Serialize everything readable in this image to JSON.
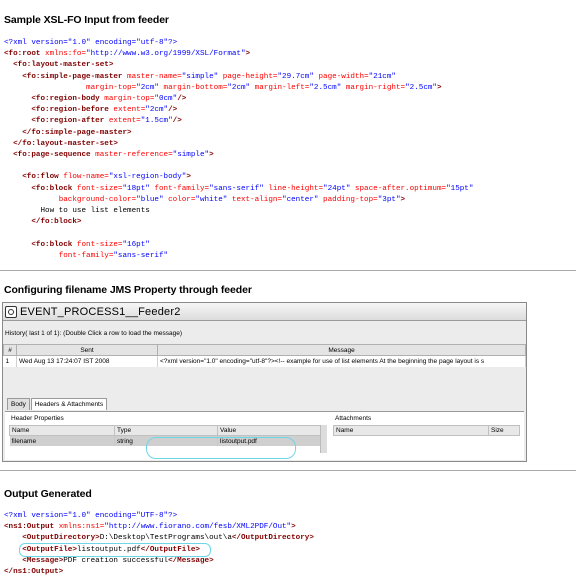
{
  "section1": {
    "heading": "Sample XSL-FO Input from feeder",
    "lines": [
      [
        {
          "c": "pi",
          "t": "<?xml version=\"1.0\" encoding=\"utf-8\"?>"
        }
      ],
      [
        {
          "c": "tag",
          "t": "<fo:root"
        },
        {
          "c": "attr",
          "t": " xmlns:fo="
        },
        {
          "c": "val",
          "t": "\"http://www.w3.org/1999/XSL/Format\""
        },
        {
          "c": "tag",
          "t": ">"
        }
      ],
      [
        {
          "c": "txt",
          "t": "  "
        },
        {
          "c": "tag",
          "t": "<fo:layout-master-set>"
        }
      ],
      [
        {
          "c": "txt",
          "t": "    "
        },
        {
          "c": "tag",
          "t": "<fo:simple-page-master"
        },
        {
          "c": "attr",
          "t": " master-name="
        },
        {
          "c": "val",
          "t": "\"simple\""
        },
        {
          "c": "attr",
          "t": " page-height="
        },
        {
          "c": "val",
          "t": "\"29.7cm\""
        },
        {
          "c": "attr",
          "t": " page-width="
        },
        {
          "c": "val",
          "t": "\"21cm\""
        }
      ],
      [
        {
          "c": "txt",
          "t": "                  "
        },
        {
          "c": "attr",
          "t": "margin-top="
        },
        {
          "c": "val",
          "t": "\"2cm\""
        },
        {
          "c": "attr",
          "t": " margin-bottom="
        },
        {
          "c": "val",
          "t": "\"2cm\""
        },
        {
          "c": "attr",
          "t": " margin-left="
        },
        {
          "c": "val",
          "t": "\"2.5cm\""
        },
        {
          "c": "attr",
          "t": " margin-right="
        },
        {
          "c": "val",
          "t": "\"2.5cm\""
        },
        {
          "c": "tag",
          "t": ">"
        }
      ],
      [
        {
          "c": "txt",
          "t": "      "
        },
        {
          "c": "tag",
          "t": "<fo:region-body"
        },
        {
          "c": "attr",
          "t": " margin-top="
        },
        {
          "c": "val",
          "t": "\"0cm\""
        },
        {
          "c": "tag",
          "t": "/>"
        }
      ],
      [
        {
          "c": "txt",
          "t": "      "
        },
        {
          "c": "tag",
          "t": "<fo:region-before"
        },
        {
          "c": "attr",
          "t": " extent="
        },
        {
          "c": "val",
          "t": "\"2cm\""
        },
        {
          "c": "tag",
          "t": "/>"
        }
      ],
      [
        {
          "c": "txt",
          "t": "      "
        },
        {
          "c": "tag",
          "t": "<fo:region-after"
        },
        {
          "c": "attr",
          "t": " extent="
        },
        {
          "c": "val",
          "t": "\"1.5cm\""
        },
        {
          "c": "tag",
          "t": "/>"
        }
      ],
      [
        {
          "c": "txt",
          "t": "    "
        },
        {
          "c": "tag",
          "t": "</fo:simple-page-master>"
        }
      ],
      [
        {
          "c": "txt",
          "t": "  "
        },
        {
          "c": "tag",
          "t": "</fo:layout-master-set>"
        }
      ],
      [
        {
          "c": "txt",
          "t": "  "
        },
        {
          "c": "tag",
          "t": "<fo:page-sequence"
        },
        {
          "c": "attr",
          "t": " master-reference="
        },
        {
          "c": "val",
          "t": "\"simple\""
        },
        {
          "c": "tag",
          "t": ">"
        }
      ],
      [
        {
          "c": "txt",
          "t": " "
        }
      ],
      [
        {
          "c": "txt",
          "t": "    "
        },
        {
          "c": "tag",
          "t": "<fo:flow"
        },
        {
          "c": "attr",
          "t": " flow-name="
        },
        {
          "c": "val",
          "t": "\"xsl-region-body\""
        },
        {
          "c": "tag",
          "t": ">"
        }
      ],
      [
        {
          "c": "txt",
          "t": "      "
        },
        {
          "c": "tag",
          "t": "<fo:block"
        },
        {
          "c": "attr",
          "t": " font-size="
        },
        {
          "c": "val",
          "t": "\"18pt\""
        },
        {
          "c": "attr",
          "t": " font-family="
        },
        {
          "c": "val",
          "t": "\"sans-serif\""
        },
        {
          "c": "attr",
          "t": " line-height="
        },
        {
          "c": "val",
          "t": "\"24pt\""
        },
        {
          "c": "attr",
          "t": " space-after.optimum="
        },
        {
          "c": "val",
          "t": "\"15pt\""
        }
      ],
      [
        {
          "c": "txt",
          "t": "            "
        },
        {
          "c": "attr",
          "t": "background-color="
        },
        {
          "c": "val",
          "t": "\"blue\""
        },
        {
          "c": "attr",
          "t": " color="
        },
        {
          "c": "val",
          "t": "\"white\""
        },
        {
          "c": "attr",
          "t": " text-align="
        },
        {
          "c": "val",
          "t": "\"center\""
        },
        {
          "c": "attr",
          "t": " padding-top="
        },
        {
          "c": "val",
          "t": "\"3pt\""
        },
        {
          "c": "tag",
          "t": ">"
        }
      ],
      [
        {
          "c": "txt",
          "t": "        How to use list elements"
        }
      ],
      [
        {
          "c": "txt",
          "t": "      "
        },
        {
          "c": "tag",
          "t": "</fo:block>"
        }
      ],
      [
        {
          "c": "txt",
          "t": " "
        }
      ],
      [
        {
          "c": "txt",
          "t": "      "
        },
        {
          "c": "tag",
          "t": "<fo:block"
        },
        {
          "c": "attr",
          "t": " font-size="
        },
        {
          "c": "val",
          "t": "\"16pt\""
        }
      ],
      [
        {
          "c": "txt",
          "t": "            "
        },
        {
          "c": "attr",
          "t": "font-family="
        },
        {
          "c": "val",
          "t": "\"sans-serif\""
        }
      ]
    ]
  },
  "section2": {
    "heading": "Configuring filename JMS Property through feeder",
    "window_title": "EVENT_PROCESS1__Feeder2",
    "history_label": "History( last 1 of 1):    (Double Click a row to load the message)",
    "history_columns": [
      "#",
      "Sent",
      "Message"
    ],
    "history_rows": [
      [
        "1",
        "Wed Aug 13 17:24:07 IST 2008",
        "<?xml version=\"1.0\" encoding=\"utf-8\"?><!-- example for use of list elements  At the beginning the page layout is s"
      ]
    ],
    "tabs": [
      "Body",
      "Headers & Attachments"
    ],
    "active_tab": 1,
    "header_properties_label": "Header Properties",
    "header_columns": [
      "Name",
      "Type",
      "Value"
    ],
    "header_rows": [
      [
        "filename",
        "string",
        "listoutput.pdf"
      ]
    ],
    "attachments_label": "Attachments",
    "attachment_columns": [
      "Name",
      "Size"
    ]
  },
  "section3": {
    "heading": "Output Generated",
    "lines": [
      [
        {
          "c": "pi",
          "t": "<?xml version=\"1.0\" encoding=\"UTF-8\"?>"
        }
      ],
      [
        {
          "c": "tag",
          "t": "<ns1:Output"
        },
        {
          "c": "attr",
          "t": " xmlns:ns1="
        },
        {
          "c": "val",
          "t": "\"http://www.fiorano.com/fesb/XML2PDF/Out\""
        },
        {
          "c": "tag",
          "t": ">"
        }
      ],
      [
        {
          "c": "txt",
          "t": "    "
        },
        {
          "c": "tag",
          "t": "<OutputDirectory>"
        },
        {
          "c": "txt",
          "t": "D:\\Desktop\\TestPrograms\\out\\a"
        },
        {
          "c": "tag",
          "t": "</OutputDirectory>"
        }
      ],
      [
        {
          "c": "txt",
          "t": "    "
        },
        {
          "c": "tag",
          "t": "<OutputFile>"
        },
        {
          "c": "txt",
          "t": "listoutput.pdf"
        },
        {
          "c": "tag",
          "t": "</OutputFile>"
        }
      ],
      [
        {
          "c": "txt",
          "t": "    "
        },
        {
          "c": "tag",
          "t": "<Message>"
        },
        {
          "c": "txt",
          "t": "PDF creation successful"
        },
        {
          "c": "tag",
          "t": "</Message>"
        }
      ],
      [
        {
          "c": "tag",
          "t": "</ns1:Output>"
        }
      ]
    ]
  }
}
